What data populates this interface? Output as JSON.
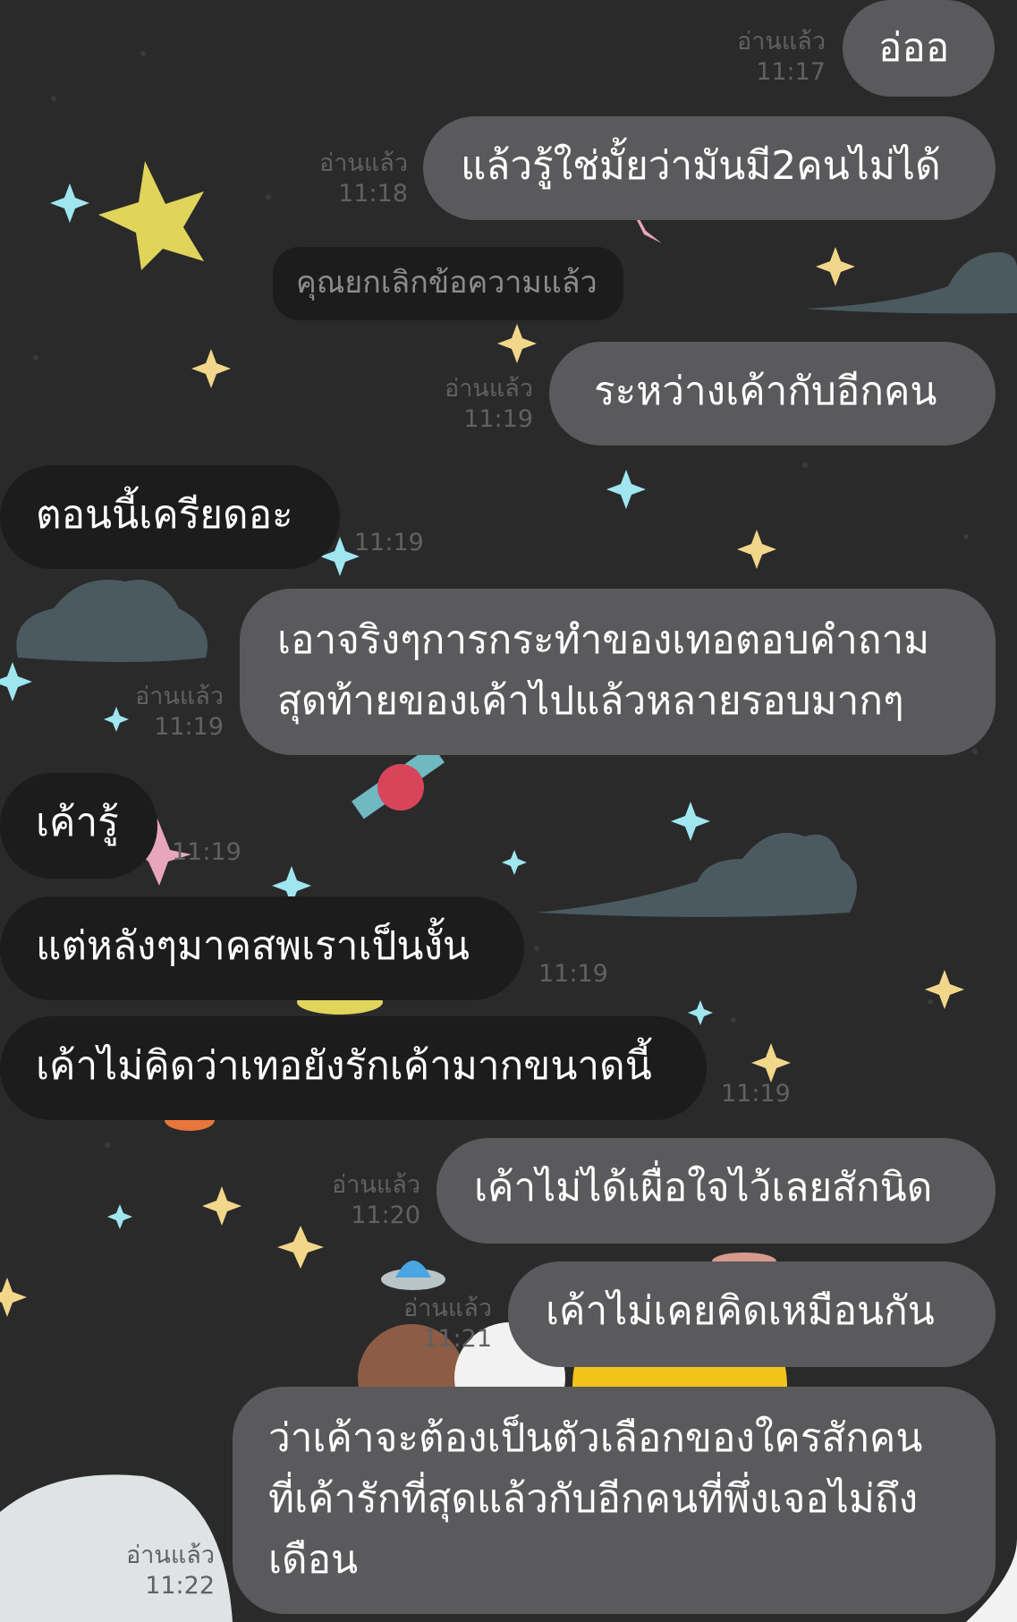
{
  "chat": {
    "messages": [
      {
        "side": "out",
        "text": "อ่ออ",
        "read": "อ่านแล้ว",
        "time": "11:17"
      },
      {
        "side": "out",
        "text": "แล้วรู้ใช่มั้ยว่ามันมี2คนไม่ได้",
        "read": "อ่านแล้ว",
        "time": "11:18"
      },
      {
        "side": "system",
        "text": "คุณยกเลิกข้อความแล้ว"
      },
      {
        "side": "out",
        "text": "ระหว่างเค้ากับอีกคน",
        "read": "อ่านแล้ว",
        "time": "11:19"
      },
      {
        "side": "in",
        "text": "ตอนนี้เครียดอะ",
        "time": "11:19"
      },
      {
        "side": "out",
        "lines": [
          "เอาจริงๆการกระทำของเทอตอบคำถาม",
          "สุดท้ายของเค้าไปแล้วหลายรอบมากๆ"
        ],
        "read": "อ่านแล้ว",
        "time": "11:19"
      },
      {
        "side": "in",
        "text": "เค้ารู้",
        "time": "11:19"
      },
      {
        "side": "in",
        "text": "แต่หลังๆมาคสพเราเป็นงั้น",
        "time": "11:19"
      },
      {
        "side": "in",
        "text": "เค้าไม่คิดว่าเทอยังรักเค้ามากขนาดนี้",
        "time": "11:19"
      },
      {
        "side": "out",
        "text": "เค้าไม่ได้เผื่อใจไว้เลยสักนิด",
        "read": "อ่านแล้ว",
        "time": "11:20"
      },
      {
        "side": "out",
        "text": "เค้าไม่เคยคิดเหมือนกัน",
        "read": "อ่านแล้ว",
        "time": "11:21"
      },
      {
        "side": "out",
        "lines": [
          "ว่าเค้าจะต้องเป็นตัวเลือกของใครสักคน",
          "ที่เค้ารักที่สุดแล้วกับอีกคนที่พึ่งเจอไม่ถึง",
          "เดือน"
        ],
        "read": "อ่านแล้ว",
        "time": "11:22"
      }
    ]
  },
  "theme": {
    "background": "#2a2a2b",
    "outgoing_bubble": "#5a5a5c",
    "incoming_bubble": "#1c1c1d",
    "meta_text": "#616162"
  }
}
